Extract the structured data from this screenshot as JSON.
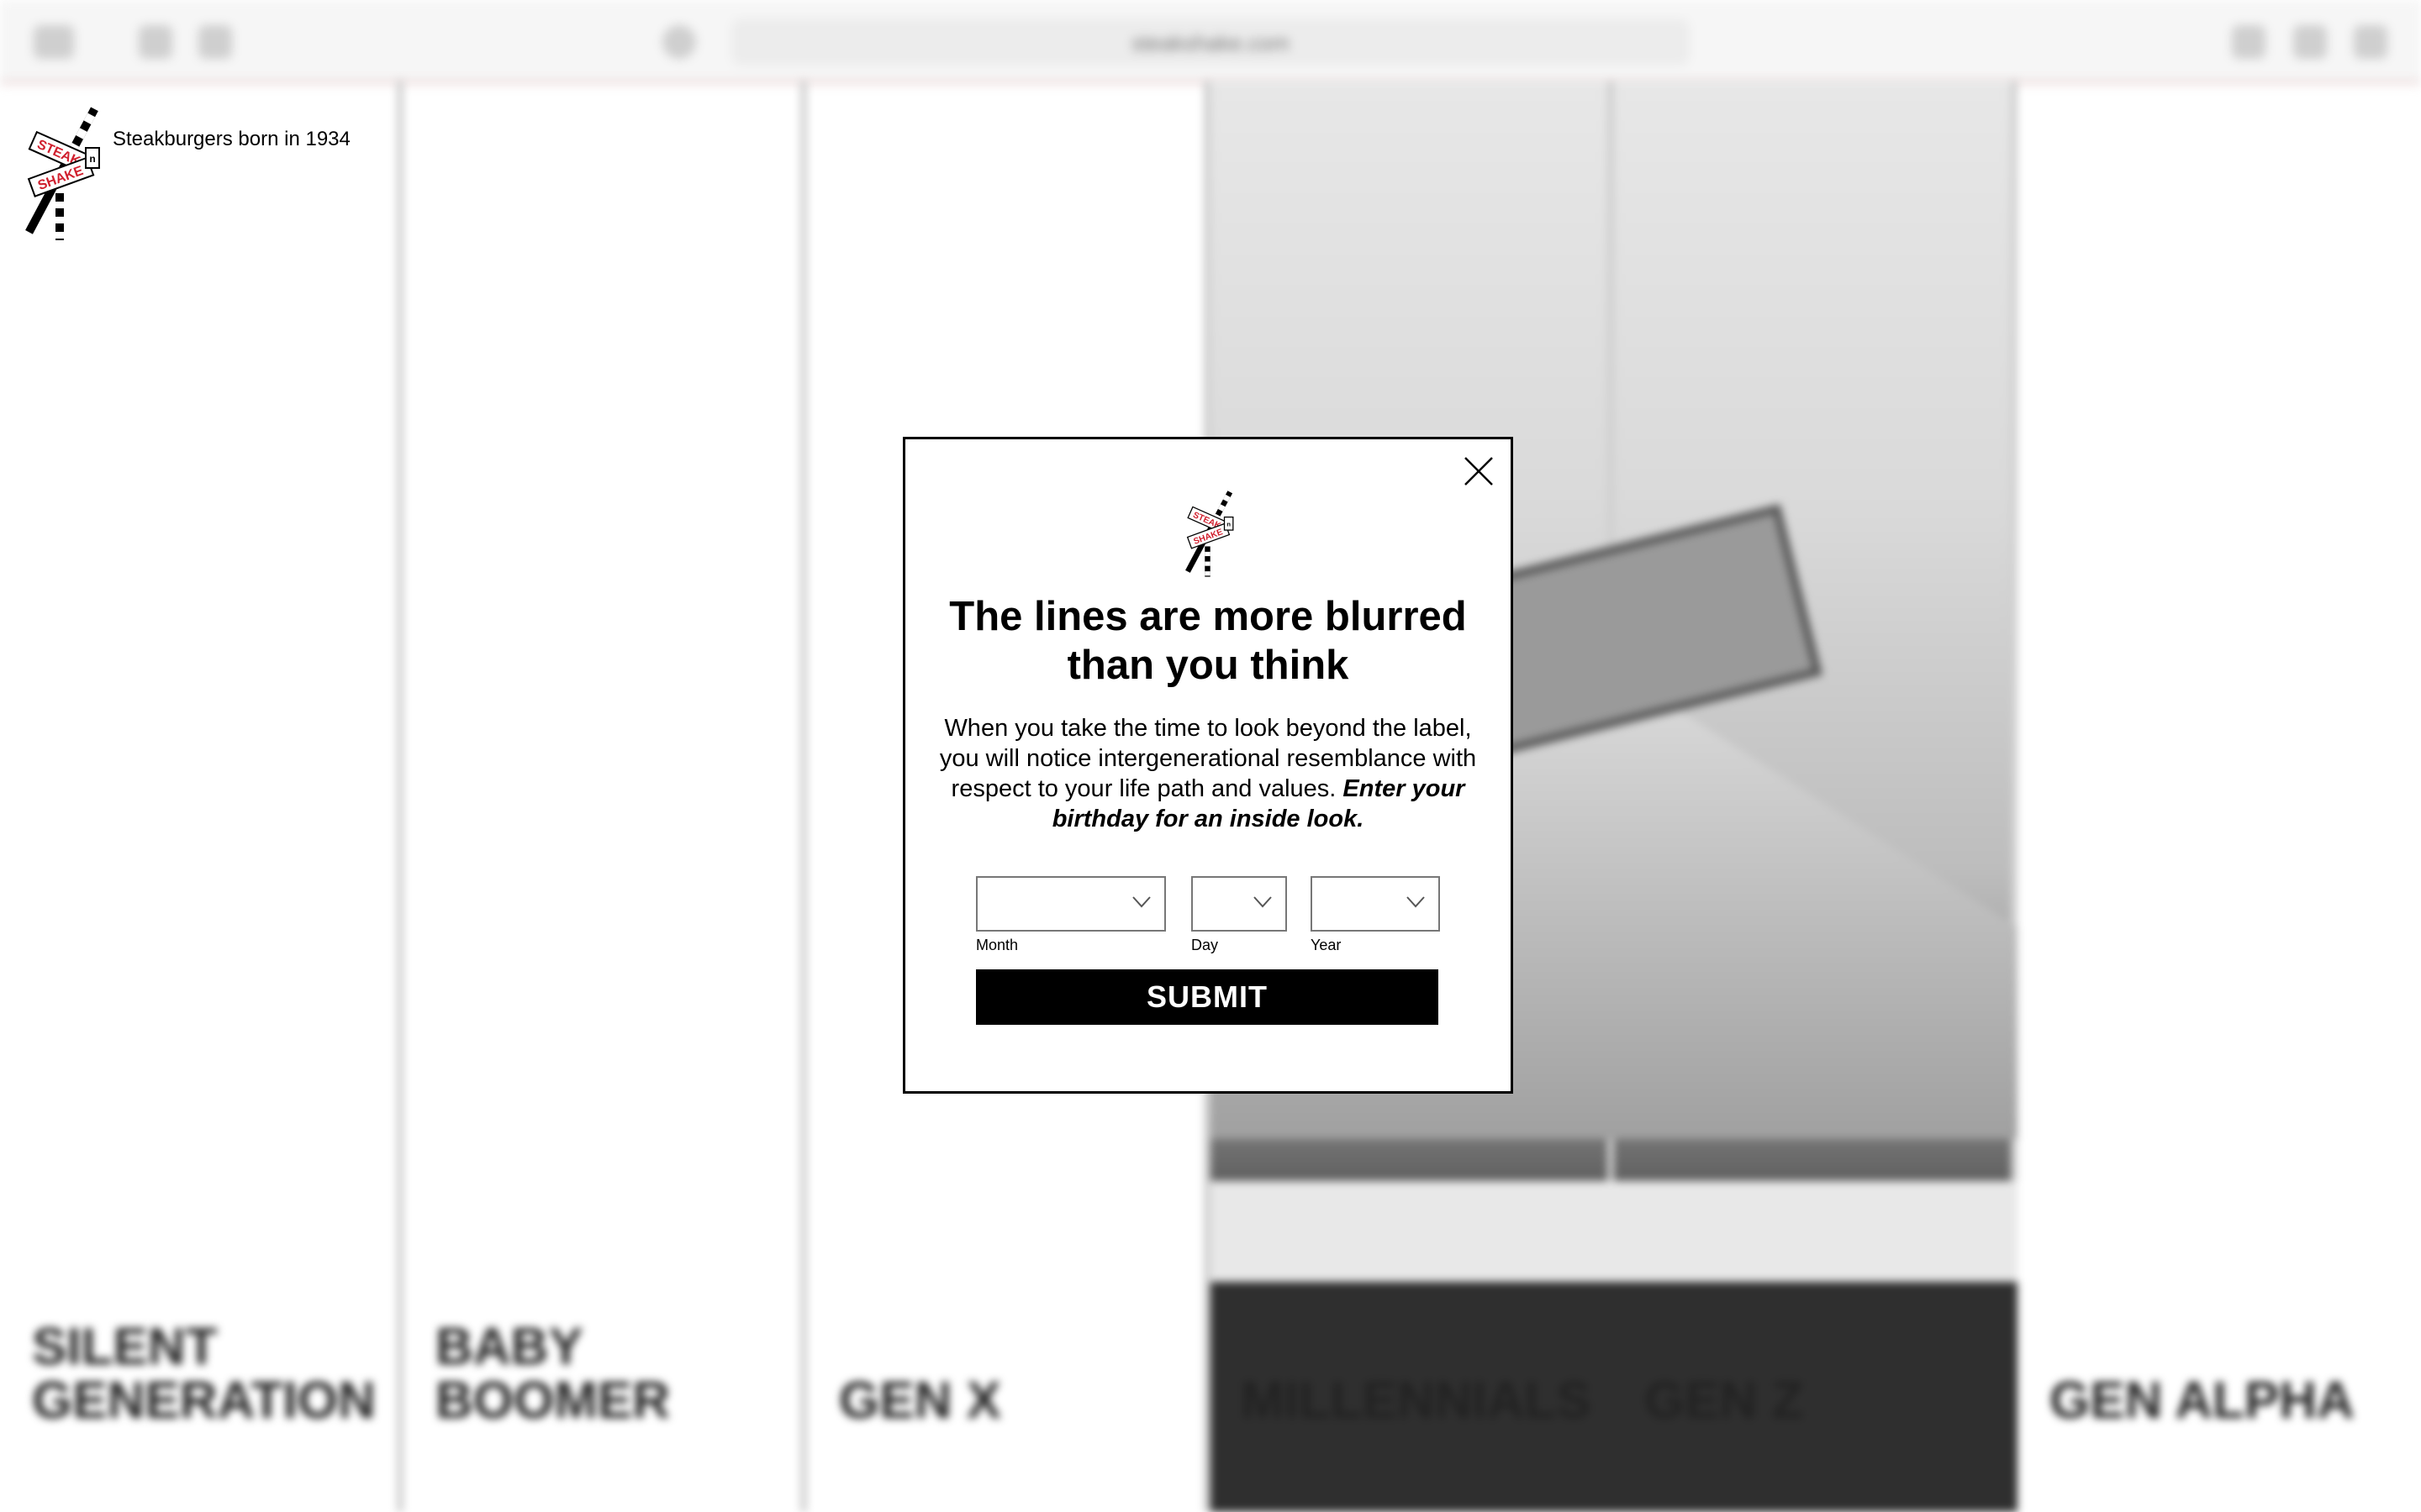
{
  "browser": {
    "url": "steakshake.com"
  },
  "brand": {
    "tagline": "Steakburgers born in 1934",
    "logo_primary": "STEAK",
    "logo_secondary": "SHAKE",
    "logo_connector": "n"
  },
  "columns": [
    {
      "label": "SILENT GENERATION"
    },
    {
      "label": "BABY BOOMER"
    },
    {
      "label": "GEN X"
    },
    {
      "label": "MILLENNIALS"
    },
    {
      "label": "GEN Z"
    },
    {
      "label": "GEN ALPHA"
    }
  ],
  "modal": {
    "title": "The lines are more blurred than you think",
    "body_text": "When you take the time to look beyond the label, you will notice intergenerational resemblance with respect to your life path and values.",
    "body_emphasis": "Enter your birthday for an inside look.",
    "fields": {
      "month_label": "Month",
      "day_label": "Day",
      "year_label": "Year",
      "month_value": "",
      "day_value": "",
      "year_value": ""
    },
    "submit_label": "SUBMIT"
  },
  "colors": {
    "brand_red": "#d0202e",
    "button_black": "#000000"
  },
  "icons": {
    "close": "close-icon",
    "chevron": "chevron-down-icon"
  }
}
